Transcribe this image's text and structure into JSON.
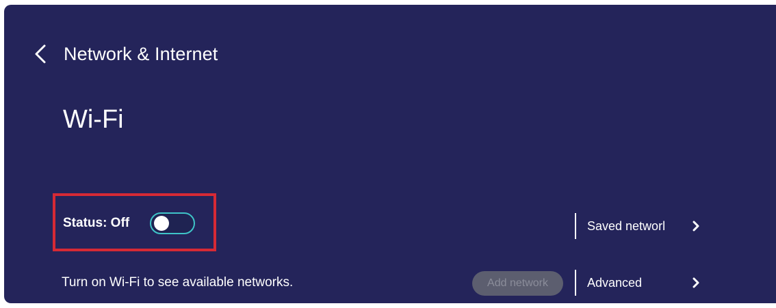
{
  "header": {
    "back_title": "Network & Internet"
  },
  "page": {
    "title": "Wi-Fi"
  },
  "status": {
    "label": "Status: Off",
    "toggle_on": false
  },
  "hint": "Turn on Wi-Fi to see available networks.",
  "buttons": {
    "add_network": "Add network"
  },
  "side_menu": {
    "saved_networks": "Saved networl",
    "advanced": "Advanced"
  },
  "colors": {
    "background": "#24245a",
    "highlight": "#d62a35",
    "toggle_border": "#3fc4c8",
    "disabled_button": "#5c5e6f"
  },
  "icons": {
    "back": "chevron-left-icon",
    "chevron": "chevron-right-icon"
  }
}
